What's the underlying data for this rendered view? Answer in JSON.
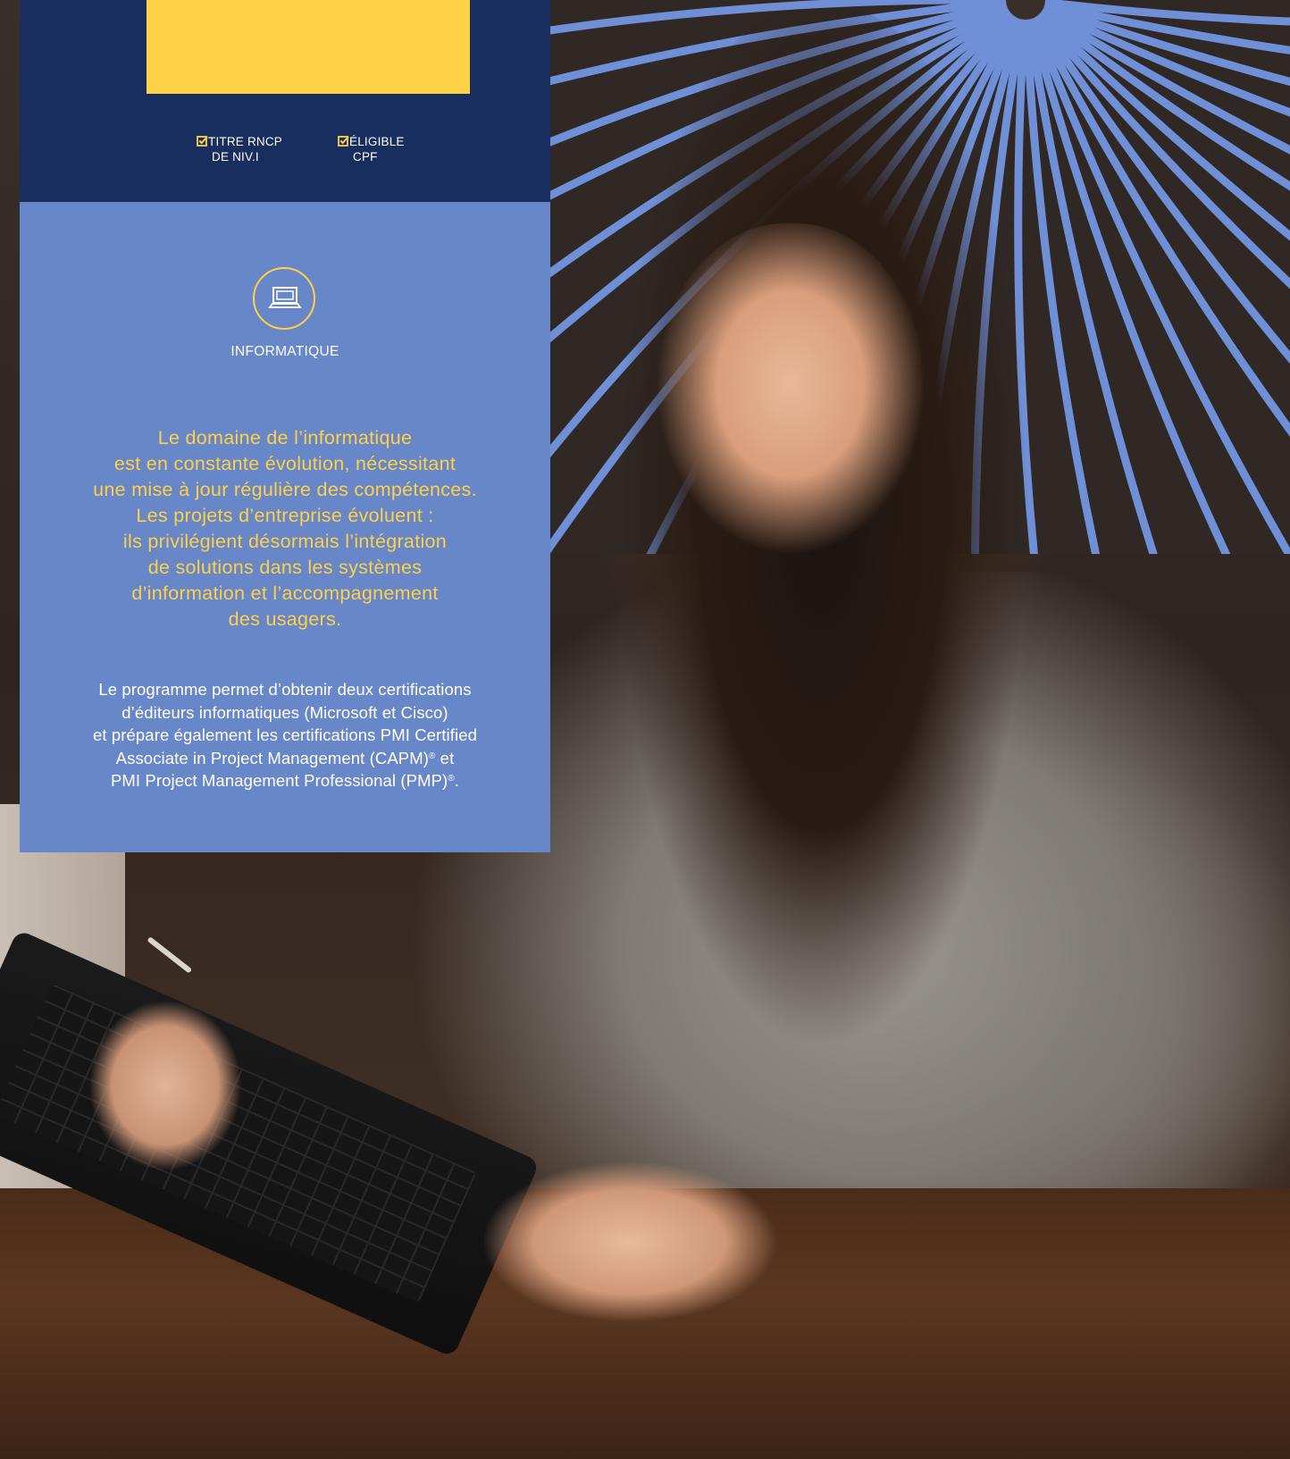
{
  "colors": {
    "navy": "#172e5e",
    "periwinkle": "#6887c9",
    "accent_yellow": "#ffd147",
    "text_white": "#ffffff"
  },
  "badges": [
    {
      "icon": "checkbox-checked-icon",
      "line1": "TITRE RNCP",
      "line2": "DE NIV.I"
    },
    {
      "icon": "checkbox-checked-icon",
      "line1": "ÉLIGIBLE",
      "line2": "CPF"
    }
  ],
  "category": {
    "icon": "laptop-icon",
    "label": "INFORMATIQUE"
  },
  "lead_lines": [
    "Le domaine de l’informatique",
    "est en constante évolution, nécessitant",
    "une mise à jour régulière des compétences.",
    "Les projets d’entreprise évoluent :",
    "ils privilégient désormais l’intégration",
    "de solutions dans les systèmes",
    "d’information et l’accompagnement",
    "des usagers."
  ],
  "body": {
    "line1": "Le programme permet d’obtenir deux certifications",
    "line2": "d’éditeurs informatiques (Microsoft et Cisco)",
    "line3": "et prépare également les certifications PMI Certified",
    "line4_a": "Associate in Project Management (CAPM)",
    "line4_b": " et",
    "line5_a": "PMI Project Management Professional (PMP)",
    "line5_b": ".",
    "registered_mark": "®"
  }
}
